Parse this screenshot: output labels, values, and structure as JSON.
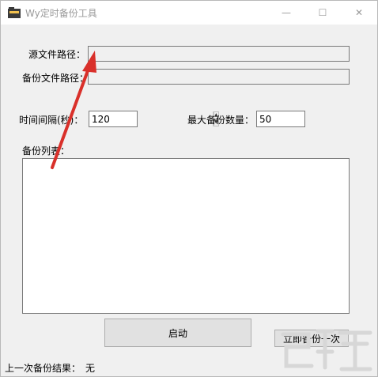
{
  "window": {
    "title": "Wy定时备份工具",
    "controls": {
      "minimize": "—",
      "maximize": "☐",
      "close": "✕"
    }
  },
  "form": {
    "source_label": "源文件路径：",
    "source_value": "",
    "backup_label": "备份文件路径：",
    "backup_value": "",
    "interval_label": "时间间隔(秒)：",
    "interval_value": "120",
    "max_label": "最大备份数量：",
    "max_value": "50",
    "list_label": "备份列表："
  },
  "buttons": {
    "start": "启动",
    "backup_now": "立即备份一次"
  },
  "status": {
    "label": "上一次备份结果：",
    "value": "无"
  },
  "annotation": {
    "arrow_color": "#d9302a"
  },
  "colors": {
    "window_bg": "#f0f0f0",
    "title_text": "#9a9a9a"
  }
}
